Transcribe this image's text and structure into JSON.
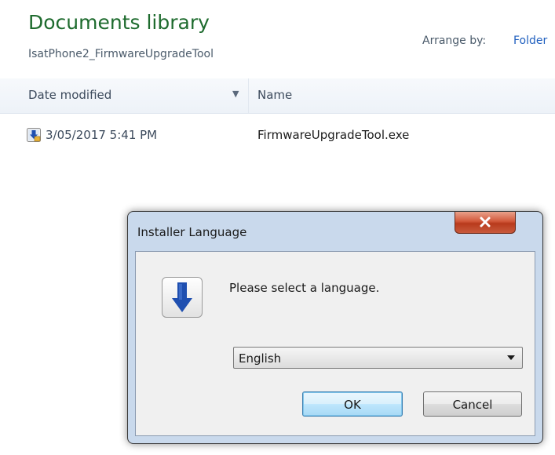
{
  "library": {
    "title": "Documents library",
    "subtitle": "IsatPhone2_FirmwareUpgradeTool",
    "arrange_label": "Arrange by:",
    "arrange_value": "Folder"
  },
  "columns": {
    "date_modified": "Date modified",
    "name": "Name"
  },
  "files": [
    {
      "date": "3/05/2017 5:41 PM",
      "name": "FirmwareUpgradeTool.exe",
      "icon": "installer-icon"
    }
  ],
  "dialog": {
    "title": "Installer Language",
    "prompt": "Please select a language.",
    "selected_language": "English",
    "ok_label": "OK",
    "cancel_label": "Cancel",
    "close_color": "#c8452a"
  },
  "colors": {
    "library_title": "#1e6b2e",
    "link": "#1f5fbf",
    "dialog_frame": "#c9d9ec"
  }
}
